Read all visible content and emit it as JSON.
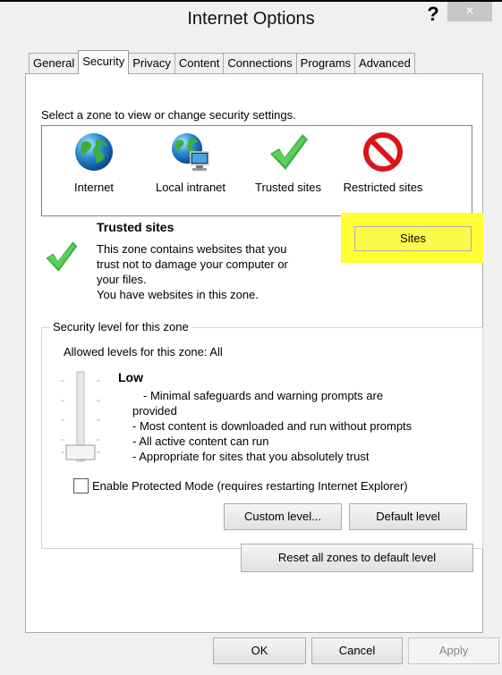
{
  "window": {
    "title": "Internet Options",
    "help_glyph": "?",
    "close_glyph": "×"
  },
  "tabs": [
    "General",
    "Security",
    "Privacy",
    "Content",
    "Connections",
    "Programs",
    "Advanced"
  ],
  "security": {
    "instruction": "Select a zone to view or change security settings.",
    "zones": [
      {
        "label": "Internet",
        "icon": "globe-icon"
      },
      {
        "label": "Local intranet",
        "icon": "globe-computer-icon"
      },
      {
        "label": "Trusted sites",
        "icon": "green-checkmark-icon"
      },
      {
        "label": "Restricted sites",
        "icon": "red-no-entry-icon"
      }
    ],
    "selected_zone": {
      "name": "Trusted sites",
      "desc_1": "This zone contains websites that you",
      "desc_2": "trust not to damage your computer or",
      "desc_3": "your files.",
      "desc_4": "You have websites in this zone."
    },
    "sites_button": "Sites",
    "level_group_label": "Security level for this zone",
    "allowed_levels": "Allowed levels for this zone: All",
    "level_name": "Low",
    "level_desc_1": "- Minimal safeguards and warning prompts are",
    "level_desc_2": "provided",
    "level_desc_3": "- Most content is downloaded and run without prompts",
    "level_desc_4": "- All active content can run",
    "level_desc_5": "- Appropriate for sites that you absolutely trust",
    "slider_level": 0,
    "protected_mode_label": "Enable Protected Mode (requires restarting Internet Explorer)",
    "protected_mode_checked": false,
    "custom_level_button": "Custom level...",
    "default_level_button": "Default level",
    "reset_button": "Reset all zones to default level"
  },
  "footer": {
    "ok": "OK",
    "cancel": "Cancel",
    "apply": "Apply"
  },
  "colors": {
    "highlight": "#ffff33",
    "check_green": "#3cb043",
    "restricted_red": "#d9151b"
  }
}
